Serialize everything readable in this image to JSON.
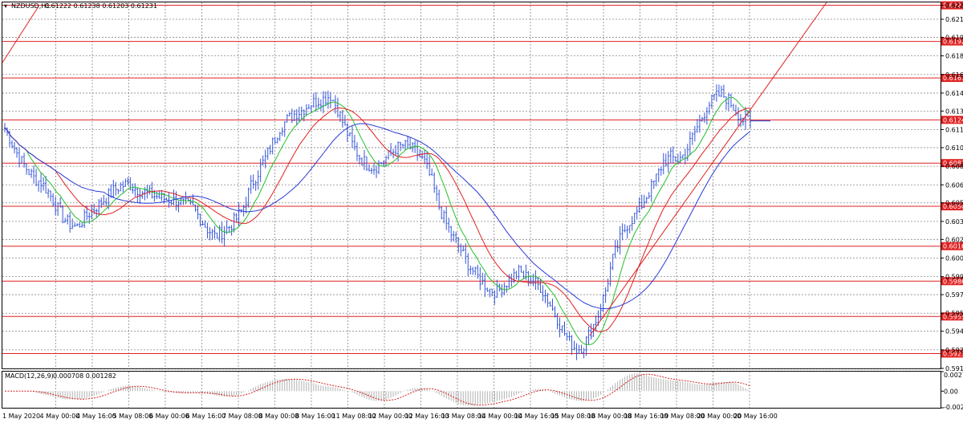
{
  "header": {
    "symbol_label": "NZDUSD,H1",
    "ohlc_text": "0.61222 0.61238 0.61203 0.61231"
  },
  "macd_header": {
    "label": "MACD(12,26,9)",
    "values_text": "0.000708 0.001282"
  },
  "colors": {
    "background": "#ffffff",
    "candles": "#3455d8",
    "ma_fast": "#22c02a",
    "ma_mid": "#e02020",
    "ma_slow": "#2a3bd6",
    "level_line": "#e02020",
    "trendline": "#e02020",
    "grid": "#888888",
    "macd_hist": "#b0b0b0",
    "macd_signal": "#d02020"
  },
  "chart_data": [
    {
      "type": "line",
      "title": "NZDUSD,H1",
      "yticks": [
        "0.62235",
        "0.62115",
        "0.61960",
        "0.61800",
        "0.61640",
        "0.61480",
        "0.61325",
        "0.61165",
        "0.61010",
        "0.60850",
        "0.60690",
        "0.60535",
        "0.60375",
        "0.60220",
        "0.60060",
        "0.59900",
        "0.59745",
        "0.59585",
        "0.59430",
        "0.59270",
        "0.59110"
      ],
      "xticks": [
        "1 May 2020",
        "4 May 00:00",
        "4 May 16:00",
        "5 May 08:00",
        "6 May 00:00",
        "6 May 16:00",
        "7 May 08:00",
        "8 May 00:00",
        "8 May 16:00",
        "11 May 08:00",
        "12 May 00:00",
        "12 May 16:00",
        "13 May 08:00",
        "14 May 00:00",
        "14 May 16:00",
        "15 May 08:00",
        "18 May 00:00",
        "18 May 16:00",
        "19 May 08:00",
        "20 May 00:00",
        "20 May 16:00"
      ],
      "ylim": [
        0.5911,
        0.6226
      ],
      "levels": [
        "0.62235",
        "0.61924",
        "0.61610",
        "0.61249",
        "0.60877",
        "0.60505",
        "0.60162",
        "0.59861",
        "0.59557",
        "0.59238"
      ],
      "current_price_label": "0.61249",
      "close_series": [
        0.6118,
        0.6105,
        0.6092,
        0.6083,
        0.6075,
        0.6071,
        0.6063,
        0.6052,
        0.6041,
        0.6035,
        0.6033,
        0.604,
        0.6047,
        0.6052,
        0.6058,
        0.6064,
        0.6068,
        0.607,
        0.6066,
        0.6063,
        0.6061,
        0.6059,
        0.6057,
        0.6056,
        0.6055,
        0.6052,
        0.6049,
        0.604,
        0.6031,
        0.6025,
        0.6028,
        0.6033,
        0.604,
        0.605,
        0.6068,
        0.608,
        0.6092,
        0.6105,
        0.6118,
        0.6125,
        0.613,
        0.6133,
        0.6138,
        0.6141,
        0.6143,
        0.6146,
        0.6134,
        0.6118,
        0.6104,
        0.6093,
        0.6087,
        0.6084,
        0.6088,
        0.6094,
        0.61,
        0.6103,
        0.6101,
        0.6096,
        0.6088,
        0.6072,
        0.605,
        0.6035,
        0.6023,
        0.6013,
        0.6001,
        0.5992,
        0.5985,
        0.5979,
        0.5977,
        0.5983,
        0.5989,
        0.5994,
        0.599,
        0.5986,
        0.5981,
        0.597,
        0.5958,
        0.5945,
        0.5934,
        0.5927,
        0.5931,
        0.5944,
        0.5957,
        0.5978,
        0.6005,
        0.6022,
        0.6035,
        0.6042,
        0.6052,
        0.6063,
        0.6075,
        0.6089,
        0.6093,
        0.609,
        0.6096,
        0.611,
        0.6123,
        0.6136,
        0.6144,
        0.6147,
        0.6142,
        0.6133,
        0.6125,
        0.6124
      ]
    },
    {
      "type": "bar",
      "title": "MACD(12,26,9)",
      "yticks": [
        "0.002743",
        "0.00",
        "-0.002337"
      ],
      "ylim": [
        -0.002337,
        0.002743
      ]
    }
  ]
}
